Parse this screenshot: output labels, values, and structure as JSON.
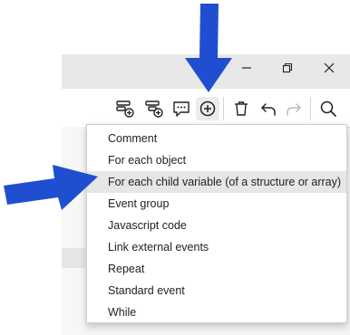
{
  "window": {
    "controls": [
      {
        "name": "minimize-button",
        "icon": "minimize-icon"
      },
      {
        "name": "restore-button",
        "icon": "restore-icon"
      },
      {
        "name": "close-button",
        "icon": "close-icon"
      }
    ]
  },
  "toolbar": {
    "buttons": [
      {
        "name": "add-event-button",
        "icon": "add-event-icon"
      },
      {
        "name": "add-subevent-button",
        "icon": "add-subevent-icon"
      },
      {
        "name": "add-comment-button",
        "icon": "comment-icon"
      },
      {
        "name": "add-other-button",
        "icon": "plus-circle-icon",
        "highlighted": true
      },
      {
        "name": "delete-button",
        "icon": "trash-icon"
      },
      {
        "name": "undo-button",
        "icon": "undo-icon"
      },
      {
        "name": "redo-button",
        "icon": "redo-icon",
        "disabled": true
      },
      {
        "name": "search-button",
        "icon": "search-icon"
      }
    ]
  },
  "menu": {
    "items": [
      "Comment",
      "For each object",
      "For each child variable (of a structure or array)",
      "Event group",
      "Javascript code",
      "Link external events",
      "Repeat",
      "Standard event",
      "While"
    ],
    "highlighted_index": 2
  },
  "annotations": {
    "arrow_color": "#1f4fd0"
  }
}
